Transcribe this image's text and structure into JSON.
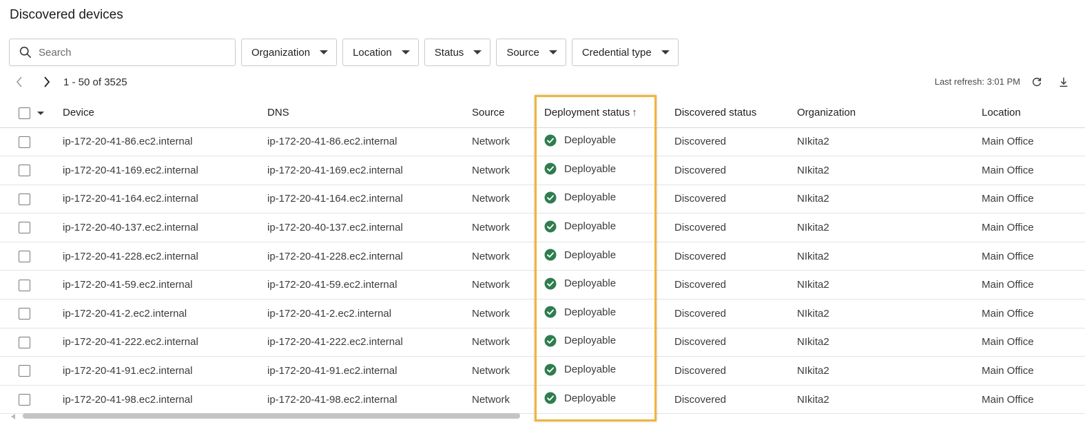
{
  "page": {
    "title": "Discovered devices"
  },
  "search": {
    "placeholder": "Search"
  },
  "filters": [
    "Organization",
    "Location",
    "Status",
    "Source",
    "Credential type"
  ],
  "pager": {
    "range": "1 - 50 of 3525"
  },
  "refresh": {
    "label": "Last refresh: 3:01 PM"
  },
  "columns": {
    "device": "Device",
    "dns": "DNS",
    "source": "Source",
    "deployment": "Deployment status",
    "discovered": "Discovered status",
    "organization": "Organization",
    "location": "Location"
  },
  "colors": {
    "accent_highlight": "#f0b53a",
    "status_ok": "#2e7d4f"
  },
  "icons": {
    "search": "search-icon",
    "prev": "chevron-left-icon",
    "next": "chevron-right-icon",
    "refresh": "refresh-icon",
    "download": "download-icon",
    "status": "check-circle-icon"
  },
  "rows": [
    {
      "device": "ip-172-20-41-86.ec2.internal",
      "dns": "ip-172-20-41-86.ec2.internal",
      "source": "Network",
      "deployment": "Deployable",
      "discovered": "Discovered",
      "organization": "NIkita2",
      "location": "Main Office"
    },
    {
      "device": "ip-172-20-41-169.ec2.internal",
      "dns": "ip-172-20-41-169.ec2.internal",
      "source": "Network",
      "deployment": "Deployable",
      "discovered": "Discovered",
      "organization": "NIkita2",
      "location": "Main Office"
    },
    {
      "device": "ip-172-20-41-164.ec2.internal",
      "dns": "ip-172-20-41-164.ec2.internal",
      "source": "Network",
      "deployment": "Deployable",
      "discovered": "Discovered",
      "organization": "NIkita2",
      "location": "Main Office"
    },
    {
      "device": "ip-172-20-40-137.ec2.internal",
      "dns": "ip-172-20-40-137.ec2.internal",
      "source": "Network",
      "deployment": "Deployable",
      "discovered": "Discovered",
      "organization": "NIkita2",
      "location": "Main Office"
    },
    {
      "device": "ip-172-20-41-228.ec2.internal",
      "dns": "ip-172-20-41-228.ec2.internal",
      "source": "Network",
      "deployment": "Deployable",
      "discovered": "Discovered",
      "organization": "NIkita2",
      "location": "Main Office"
    },
    {
      "device": "ip-172-20-41-59.ec2.internal",
      "dns": "ip-172-20-41-59.ec2.internal",
      "source": "Network",
      "deployment": "Deployable",
      "discovered": "Discovered",
      "organization": "NIkita2",
      "location": "Main Office"
    },
    {
      "device": "ip-172-20-41-2.ec2.internal",
      "dns": "ip-172-20-41-2.ec2.internal",
      "source": "Network",
      "deployment": "Deployable",
      "discovered": "Discovered",
      "organization": "NIkita2",
      "location": "Main Office"
    },
    {
      "device": "ip-172-20-41-222.ec2.internal",
      "dns": "ip-172-20-41-222.ec2.internal",
      "source": "Network",
      "deployment": "Deployable",
      "discovered": "Discovered",
      "organization": "NIkita2",
      "location": "Main Office"
    },
    {
      "device": "ip-172-20-41-91.ec2.internal",
      "dns": "ip-172-20-41-91.ec2.internal",
      "source": "Network",
      "deployment": "Deployable",
      "discovered": "Discovered",
      "organization": "NIkita2",
      "location": "Main Office"
    },
    {
      "device": "ip-172-20-41-98.ec2.internal",
      "dns": "ip-172-20-41-98.ec2.internal",
      "source": "Network",
      "deployment": "Deployable",
      "discovered": "Discovered",
      "organization": "NIkita2",
      "location": "Main Office"
    }
  ]
}
